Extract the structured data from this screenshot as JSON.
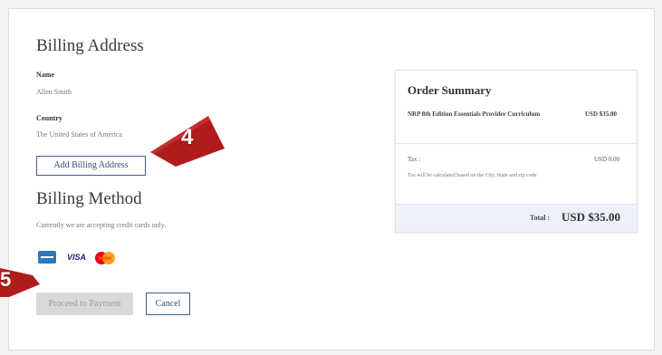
{
  "billing_address": {
    "title": "Billing Address",
    "name_label": "Name",
    "name_value": "Allen Smith",
    "country_label": "Country",
    "country_value": "The United States of America",
    "add_button": "Add Billing Address"
  },
  "billing_method": {
    "title": "Billing Method",
    "note": "Currently we are accepting credit cards only.",
    "cards": [
      "amex-icon",
      "visa-icon",
      "mastercard-icon"
    ],
    "visa_text": "VISA"
  },
  "actions": {
    "proceed_label": "Proceed to Payment",
    "cancel_label": "Cancel"
  },
  "order_summary": {
    "title": "Order Summary",
    "item_name": "NRP 8th Edition Essentials Provider Curriculum",
    "item_price": "USD $35.00",
    "tax_label": "Tax :",
    "tax_value": "USD 0.00",
    "tax_note": "Tax will be calculated based on the City, State and zip code",
    "total_label": "Total :",
    "total_value": "USD $35.00"
  },
  "callouts": {
    "step_4": "4",
    "step_5": "5"
  },
  "colors": {
    "accent": "#3f5f8f",
    "callout": "#b01c1c",
    "summary_footer": "#eef1fb"
  }
}
